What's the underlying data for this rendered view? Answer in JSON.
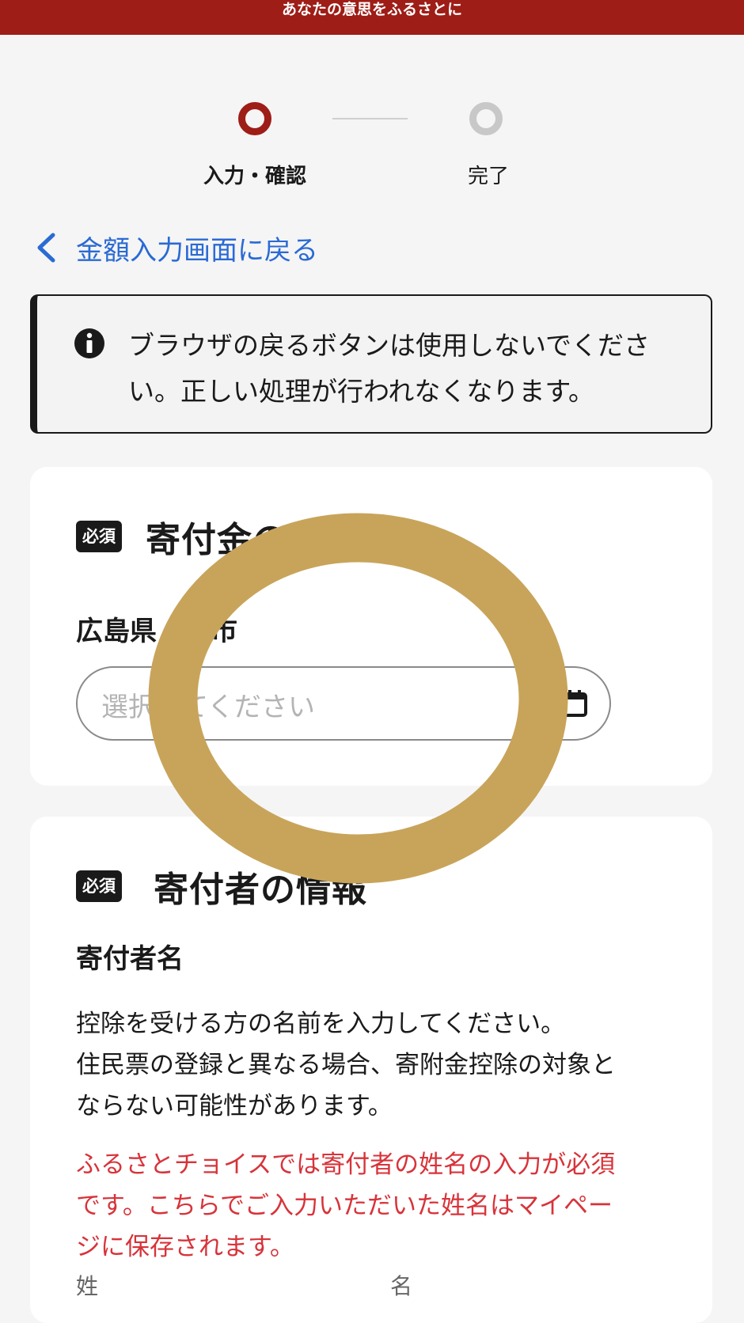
{
  "header": {
    "tagline": "あなたの意思をふるさとに"
  },
  "stepper": {
    "steps": [
      {
        "label": "入力・確認",
        "state": "active"
      },
      {
        "label": "完了",
        "state": "inactive"
      }
    ]
  },
  "nav": {
    "back_label": "金額入力画面に戻る"
  },
  "notice": {
    "icon": "info-icon",
    "line1": "ブラウザの戻るボタンは使用しないでくださ",
    "line2": "い。正しい処理が行われなくなります。"
  },
  "usage_card": {
    "badge": "必須",
    "title": "寄付金の",
    "municipality": "広島県　島市",
    "select_placeholder": "選択してください"
  },
  "donor_card": {
    "badge": "必須",
    "title": "寄付者の情報",
    "name_label": "寄付者名",
    "desc_lines": [
      "控除を受ける方の名前を入力してください。",
      "住民票の登録と異なる場合、寄附金控除の対象と",
      "ならない可能性があります。"
    ],
    "warn_lines": [
      "ふるさとチョイスでは寄付者の姓名の入力が必須",
      "です。こちらでご入力いただいた姓名はマイペー",
      "ジに保存されます。"
    ],
    "last_name_label": "姓",
    "first_name_label": "名"
  },
  "colors": {
    "brand": "#9e1d17",
    "link": "#2a6ad4",
    "warning": "#d8333a",
    "overlay_ring": "#c8a45a"
  }
}
